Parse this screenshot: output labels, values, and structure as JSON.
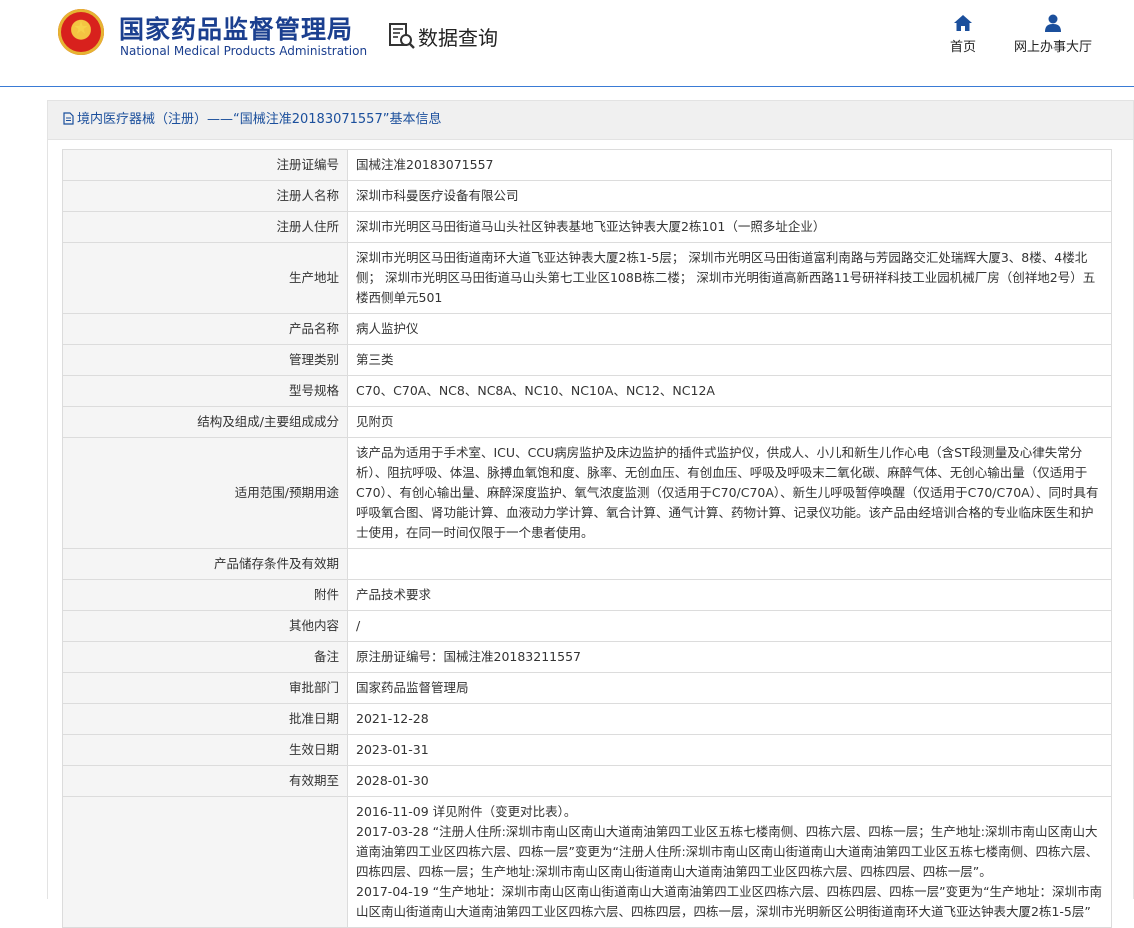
{
  "header": {
    "org_name_cn": "国家药品监督管理局",
    "org_name_en": "National Medical Products Administration",
    "section_title": "数据查询",
    "nav": {
      "home_label": "首页",
      "hall_label": "网上办事大厅"
    }
  },
  "panel": {
    "title": "境内医疗器械（注册）——“国械注准20183071557”基本信息"
  },
  "rows": [
    {
      "key": "注册证编号",
      "value": "国械注准20183071557"
    },
    {
      "key": "注册人名称",
      "value": "深圳市科曼医疗设备有限公司"
    },
    {
      "key": "注册人住所",
      "value": "深圳市光明区马田街道马山头社区钟表基地飞亚达钟表大厦2栋101（一照多址企业）"
    },
    {
      "key": "生产地址",
      "value": "深圳市光明区马田街道南环大道飞亚达钟表大厦2栋1-5层； 深圳市光明区马田街道富利南路与芳园路交汇处瑞辉大厦3、8楼、4楼北侧； 深圳市光明区马田街道马山头第七工业区108B栋二楼； 深圳市光明街道高新西路11号研祥科技工业园机械厂房（创祥地2号）五楼西侧单元501"
    },
    {
      "key": "产品名称",
      "value": "病人监护仪"
    },
    {
      "key": "管理类别",
      "value": "第三类"
    },
    {
      "key": "型号规格",
      "value": "C70、C70A、NC8、NC8A、NC10、NC10A、NC12、NC12A"
    },
    {
      "key": "结构及组成/主要组成成分",
      "value": "见附页"
    },
    {
      "key": "适用范围/预期用途",
      "value": "该产品为适用于手术室、ICU、CCU病房监护及床边监护的插件式监护仪，供成人、小儿和新生儿作心电（含ST段测量及心律失常分析）、阻抗呼吸、体温、脉搏血氧饱和度、脉率、无创血压、有创血压、呼吸及呼吸末二氧化碳、麻醉气体、无创心输出量（仅适用于C70）、有创心输出量、麻醉深度监护、氧气浓度监测（仅适用于C70/C70A）、新生儿呼吸暂停唤醒（仅适用于C70/C70A）、同时具有呼吸氧合图、肾功能计算、血液动力学计算、氧合计算、通气计算、药物计算、记录仪功能。该产品由经培训合格的专业临床医生和护士使用，在同一时间仅限于一个患者使用。"
    },
    {
      "key": "产品储存条件及有效期",
      "value": ""
    },
    {
      "key": "附件",
      "value": "产品技术要求"
    },
    {
      "key": "其他内容",
      "value": "/"
    },
    {
      "key": "备注",
      "value": "原注册证编号：国械注准20183211557"
    },
    {
      "key": "审批部门",
      "value": "国家药品监督管理局"
    },
    {
      "key": "批准日期",
      "value": "2021-12-28"
    },
    {
      "key": "生效日期",
      "value": "2023-01-31"
    },
    {
      "key": "有效期至",
      "value": "2028-01-30"
    }
  ],
  "change_history": [
    "2016-11-09 详见附件（变更对比表）。",
    "2017-03-28 “注册人住所:深圳市南山区南山大道南油第四工业区五栋七楼南侧、四栋六层、四栋一层；生产地址:深圳市南山区南山大道南油第四工业区四栋六层、四栋一层”变更为“注册人住所:深圳市南山区南山街道南山大道南油第四工业区五栋七楼南侧、四栋六层、四栋四层、四栋一层；生产地址:深圳市南山区南山街道南山大道南油第四工业区四栋六层、四栋四层、四栋一层”。",
    "2017-04-19 “生产地址：深圳市南山区南山街道南山大道南油第四工业区四栋六层、四栋四层、四栋一层”变更为“生产地址：深圳市南山区南山街道南山大道南油第四工业区四栋六层、四栋四层，四栋一层，深圳市光明新区公明街道南环大道飞亚达钟表大厦2栋1-5层”"
  ]
}
